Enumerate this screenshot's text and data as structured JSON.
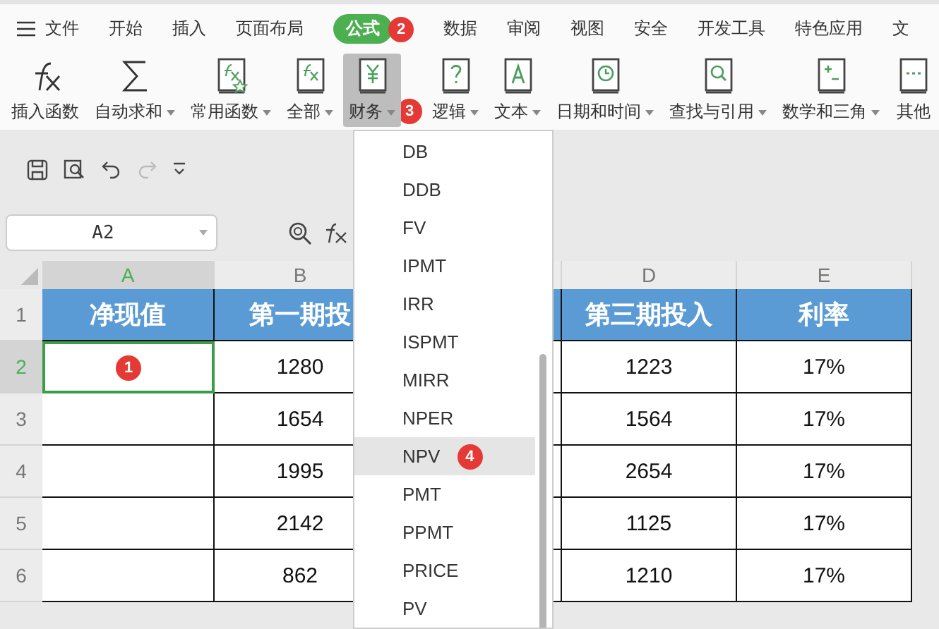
{
  "menu": {
    "tabs": [
      {
        "label": "文件",
        "kind": "file",
        "selected": false
      },
      {
        "label": "开始",
        "kind": "tab",
        "selected": false
      },
      {
        "label": "插入",
        "kind": "tab",
        "selected": false
      },
      {
        "label": "页面布局",
        "kind": "tab",
        "selected": false
      },
      {
        "label": "公式",
        "kind": "tab",
        "selected": true,
        "badge": "2"
      },
      {
        "label": "数据",
        "kind": "tab",
        "selected": false
      },
      {
        "label": "审阅",
        "kind": "tab",
        "selected": false
      },
      {
        "label": "视图",
        "kind": "tab",
        "selected": false
      },
      {
        "label": "安全",
        "kind": "tab",
        "selected": false
      },
      {
        "label": "开发工具",
        "kind": "tab",
        "selected": false
      },
      {
        "label": "特色应用",
        "kind": "tab",
        "selected": false
      },
      {
        "label": "文",
        "kind": "tab",
        "selected": false
      }
    ]
  },
  "ribbon": {
    "items": [
      {
        "label": "插入函数",
        "kind": "fx",
        "has_menu": false,
        "selected": false
      },
      {
        "label": "自动求和",
        "kind": "sigma",
        "has_menu": true,
        "selected": false
      },
      {
        "label": "常用函数",
        "kind": "favorites",
        "has_menu": true,
        "selected": false
      },
      {
        "label": "全部",
        "kind": "all",
        "has_menu": true,
        "selected": false
      },
      {
        "label": "财务",
        "kind": "finance",
        "has_menu": true,
        "selected": true,
        "badge": "3"
      },
      {
        "label": "逻辑",
        "kind": "logic",
        "has_menu": true,
        "selected": false
      },
      {
        "label": "文本",
        "kind": "text",
        "has_menu": true,
        "selected": false
      },
      {
        "label": "日期和时间",
        "kind": "datetime",
        "has_menu": true,
        "selected": false
      },
      {
        "label": "查找与引用",
        "kind": "lookup",
        "has_menu": true,
        "selected": false
      },
      {
        "label": "数学和三角",
        "kind": "math",
        "has_menu": true,
        "selected": false
      },
      {
        "label": "其他",
        "kind": "other",
        "has_menu": false,
        "selected": false
      }
    ]
  },
  "formula_bar": {
    "name_box": "A2"
  },
  "sheet": {
    "columns": [
      {
        "label": "A",
        "selected": true
      },
      {
        "label": "B",
        "selected": false
      },
      {
        "label": "D",
        "selected": false
      },
      {
        "label": "E",
        "selected": false
      }
    ],
    "rows": [
      {
        "number": "1",
        "kind": "header",
        "selected": false,
        "cells": [
          {
            "text": "净现值",
            "selected": false
          },
          {
            "text": "第一期投",
            "selected": false
          },
          {
            "text": "第三期投入",
            "selected": false
          },
          {
            "text": "利率",
            "selected": false
          }
        ]
      },
      {
        "number": "2",
        "kind": "data",
        "selected": true,
        "cells": [
          {
            "selected": true,
            "badge": "1"
          },
          {
            "text": "1280",
            "selected": false
          },
          {
            "text": "1223",
            "selected": false
          },
          {
            "text": "17%",
            "selected": false
          }
        ]
      },
      {
        "number": "3",
        "kind": "data",
        "selected": false,
        "cells": [
          {
            "selected": false
          },
          {
            "text": "1654",
            "selected": false
          },
          {
            "text": "1564",
            "selected": false
          },
          {
            "text": "17%",
            "selected": false
          }
        ]
      },
      {
        "number": "4",
        "kind": "data",
        "selected": false,
        "cells": [
          {
            "selected": false
          },
          {
            "text": "1995",
            "selected": false
          },
          {
            "text": "2654",
            "selected": false
          },
          {
            "text": "17%",
            "selected": false
          }
        ]
      },
      {
        "number": "5",
        "kind": "data",
        "selected": false,
        "cells": [
          {
            "selected": false
          },
          {
            "text": "2142",
            "selected": false
          },
          {
            "text": "1125",
            "selected": false
          },
          {
            "text": "17%",
            "selected": false
          }
        ]
      },
      {
        "number": "6",
        "kind": "data",
        "selected": false,
        "cells": [
          {
            "selected": false
          },
          {
            "text": "862",
            "selected": false
          },
          {
            "text": "1210",
            "selected": false
          },
          {
            "text": "17%",
            "selected": false
          }
        ]
      }
    ]
  },
  "function_menu": {
    "items": [
      {
        "label": "DB",
        "selected": false
      },
      {
        "label": "DDB",
        "selected": false
      },
      {
        "label": "FV",
        "selected": false
      },
      {
        "label": "IPMT",
        "selected": false
      },
      {
        "label": "IRR",
        "selected": false
      },
      {
        "label": "ISPMT",
        "selected": false
      },
      {
        "label": "MIRR",
        "selected": false
      },
      {
        "label": "NPER",
        "selected": false
      },
      {
        "label": "NPV",
        "selected": true,
        "badge": "4"
      },
      {
        "label": "PMT",
        "selected": false
      },
      {
        "label": "PPMT",
        "selected": false
      },
      {
        "label": "PRICE",
        "selected": false
      },
      {
        "label": "PV",
        "selected": false
      }
    ]
  }
}
